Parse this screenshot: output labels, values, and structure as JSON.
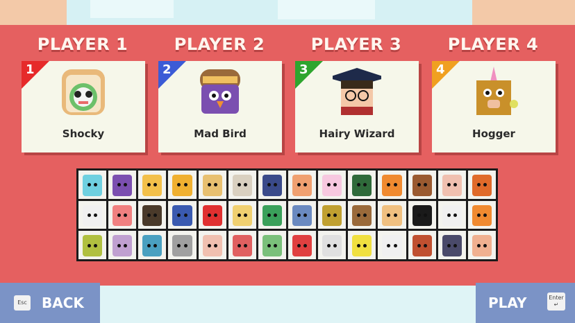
{
  "players": [
    {
      "header": "PLAYER 1",
      "number": "1",
      "name": "Shocky",
      "color": "#e62a2a",
      "character": "toast-cat"
    },
    {
      "header": "PLAYER 2",
      "number": "2",
      "name": "Mad Bird",
      "color": "#3b5bd6",
      "character": "aviator-bird"
    },
    {
      "header": "PLAYER 3",
      "number": "3",
      "name": "Hairy Wizard",
      "color": "#2ea52e",
      "character": "graduate-wizard"
    },
    {
      "header": "PLAYER 4",
      "number": "4",
      "name": "Hogger",
      "color": "#f0a020",
      "character": "unicorn-pig"
    }
  ],
  "character_grid": [
    [
      "#6fd0e0",
      "#7b4fb0",
      "#f3c04a",
      "#f0b030",
      "#e8c070",
      "#d9d0c0",
      "#3a4a8a",
      "#f0a070",
      "#f7c8e0",
      "#2f6a3a",
      "#f08a30",
      "#9a5a30",
      "#f0c0b0",
      "#e06a2a"
    ],
    [
      "#f0f0f0",
      "#f08080",
      "#4a3a2a",
      "#3a5ab0",
      "#e03030",
      "#f0d070",
      "#3aa05a",
      "#6a8ac0",
      "#c0a030",
      "#9a6a3a",
      "#f0c080",
      "#1a1a1a",
      "#f0f0f0",
      "#f08a30"
    ],
    [
      "#b0c040",
      "#c0a0d0",
      "#4aa0c0",
      "#a0a0a0",
      "#f0c0b0",
      "#e06060",
      "#7ac07a",
      "#e04040",
      "#e0e0e0",
      "#f0e040",
      "#f0f0f0",
      "#c05030",
      "#4a4a6a",
      "#f0b090"
    ]
  ],
  "buttons": {
    "back_label": "BACK",
    "back_key": "Esc",
    "play_label": "PLAY",
    "play_key": "Enter ↵"
  },
  "colors": {
    "panel": "#e56060",
    "card": "#f6f7ea",
    "button": "#7b93c6"
  }
}
